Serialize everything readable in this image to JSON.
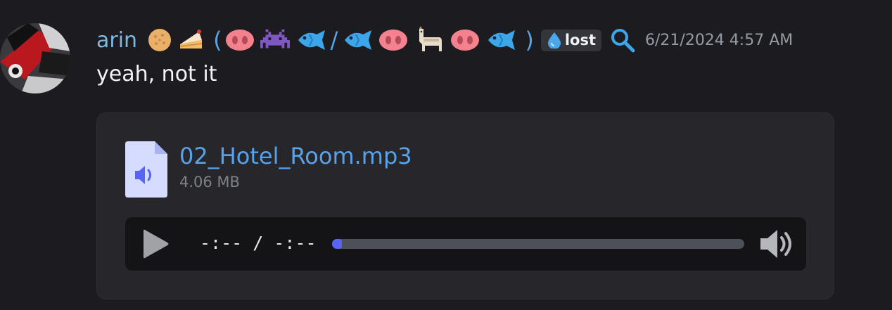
{
  "message": {
    "username": "arin",
    "paren_open": "(",
    "slash": "/",
    "paren_close": ")",
    "tag_label": "lost",
    "timestamp": "6/21/2024 4:57 AM",
    "text": "yeah, not it"
  },
  "attachment": {
    "file_name": "02_Hotel_Room.mp3",
    "file_size": "4.06 MB",
    "time_display": "-:-- / -:--",
    "progress_fraction": 0.02
  },
  "icons": {
    "avatar": "avatar-image",
    "name_emojis": [
      "cookie-emoji",
      "cake-emoji"
    ],
    "bio_emojis": [
      "pig-nose-emoji",
      "alien-monster-emoji",
      "fish-emoji",
      "fish-emoji",
      "pig-nose-emoji",
      "llama-emoji",
      "pig-nose-emoji",
      "fish-emoji"
    ],
    "tag": "droplet-icon",
    "search": "magnifier-icon",
    "file": "audio-file-icon",
    "play": "play-icon",
    "volume": "volume-icon"
  },
  "colors": {
    "username": "#7cb8e0",
    "link": "#5aa2e8",
    "progress": "#5865f2",
    "background": "#1c1b20"
  }
}
